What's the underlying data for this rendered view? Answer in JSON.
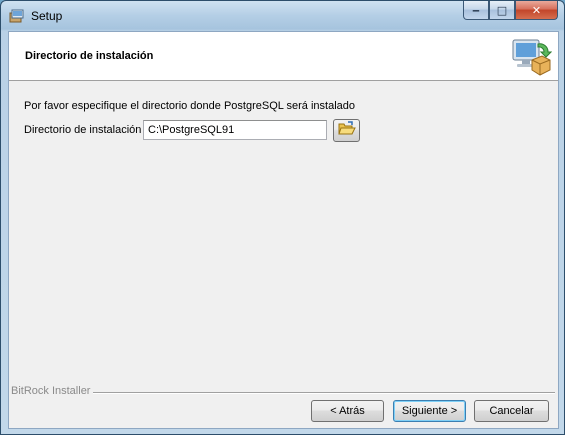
{
  "window": {
    "title": "Setup",
    "controls": {
      "minimize": "‒",
      "maximize": "□",
      "close": "✕"
    },
    "icons": {
      "app": "setup-box-icon",
      "header": "computer-install-icon",
      "browse": "folder-open-icon"
    }
  },
  "header": {
    "title": "Directorio de instalación"
  },
  "main": {
    "description": "Por favor especifique el directorio donde PostgreSQL será instalado",
    "field_label": "Directorio de instalación",
    "field_value": "C:\\PostgreSQL91"
  },
  "footer": {
    "installer_label": "BitRock Installer",
    "back_label": "< Atrás",
    "next_label": "Siguiente >",
    "cancel_label": "Cancelar"
  }
}
